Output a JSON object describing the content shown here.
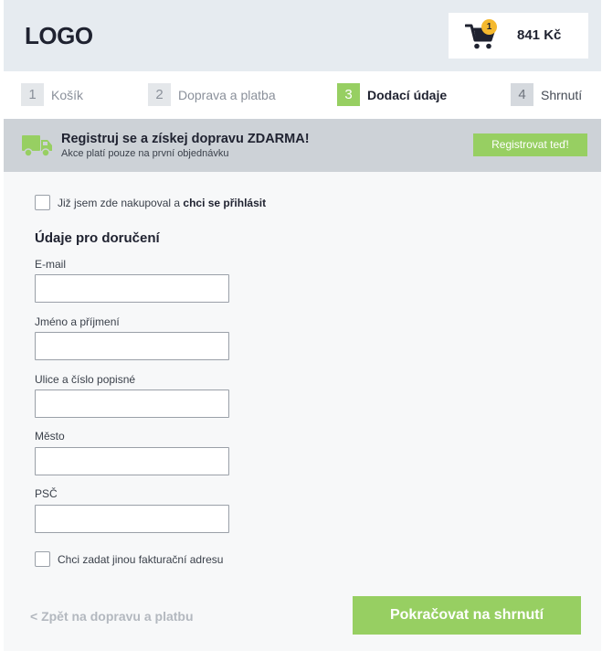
{
  "header": {
    "logo": "LOGO",
    "cart": {
      "icon": "cart-icon",
      "count": "1",
      "price": "841 Kč"
    }
  },
  "steps": [
    {
      "num": "1",
      "label": "Košík",
      "state": "done"
    },
    {
      "num": "2",
      "label": "Doprava a platba",
      "state": "done"
    },
    {
      "num": "3",
      "label": "Dodací údaje",
      "state": "active"
    },
    {
      "num": "4",
      "label": "Shrnutí",
      "state": "next"
    }
  ],
  "promo": {
    "icon": "truck-icon",
    "title": "Registruj se a získej dopravu ZDARMA!",
    "subtitle": "Akce platí pouze na první objednávku",
    "button": "Registrovat teď!"
  },
  "form": {
    "login_checkbox": {
      "text": "Již jsem zde nakupoval a ",
      "link": "chci se přihlásit",
      "checked": false
    },
    "section_title": "Údaje pro doručení",
    "fields": [
      {
        "label": "E-mail",
        "value": ""
      },
      {
        "label": "Jméno a příjmení",
        "value": ""
      },
      {
        "label": "Ulice a číslo popisné",
        "value": ""
      },
      {
        "label": "Město",
        "value": ""
      },
      {
        "label": "PSČ",
        "value": ""
      }
    ],
    "billing_checkbox": {
      "label": "Chci zadat jinou fakturační adresu",
      "checked": false
    }
  },
  "footer": {
    "back": "< Zpět na dopravu a platbu",
    "continue": "Pokračovat na shrnutí"
  },
  "colors": {
    "accent": "#97cf62",
    "badge": "#f5b92e",
    "header_bg": "#e6ebf0",
    "banner_bg": "#cdd2d7"
  }
}
